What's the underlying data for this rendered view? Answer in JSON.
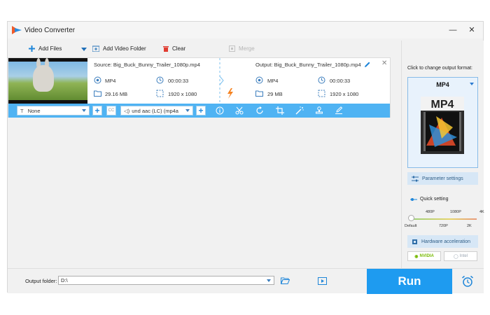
{
  "window": {
    "title": "Video Converter",
    "minimize": "—",
    "close": "✕"
  },
  "toolbar": {
    "add_files": "Add Files",
    "add_folder": "Add Video Folder",
    "clear": "Clear",
    "merge": "Merge"
  },
  "file": {
    "source_label": "Source: Big_Buck_Bunny_Trailer_1080p.mp4",
    "output_label": "Output: Big_Buck_Bunny_Trailer_1080p.mp4",
    "source": {
      "format": "MP4",
      "duration": "00:00:33",
      "size": "29.16 MB",
      "resolution": "1920 x 1080"
    },
    "output": {
      "format": "MP4",
      "duration": "00:00:33",
      "size": "29 MB",
      "resolution": "1920 x 1080"
    }
  },
  "edit_bar": {
    "subtitle_value": "None",
    "cc_label": "CC",
    "audio_value": "und aac (LC) (mp4a"
  },
  "right_panel": {
    "title": "Click to change output format:",
    "format": "MP4",
    "format_art_text": "MP4",
    "parameter_settings": "Parameter settings",
    "quick_setting": "Quick setting",
    "slider_top_labels": [
      "480P",
      "1080P",
      "4K"
    ],
    "slider_bottom_labels": [
      "Default",
      "720P",
      "2K"
    ],
    "quick_setting_level": 0,
    "hardware_acceleration": "Hardware acceleration",
    "nvidia": "NVIDIA",
    "intel": "Intel"
  },
  "bottom": {
    "output_folder_label": "Output folder:",
    "output_folder_value": "D:\\",
    "run_label": "Run"
  },
  "colors": {
    "accent": "#1e9bf0",
    "edit_bar": "#4fb3f3",
    "orange": "#f58220"
  }
}
